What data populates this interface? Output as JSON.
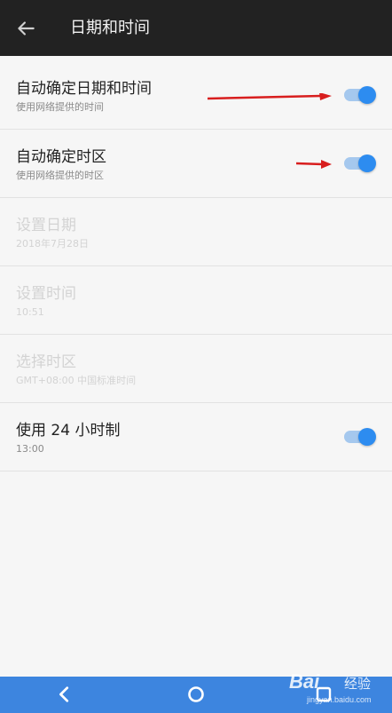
{
  "header": {
    "title": "日期和时间"
  },
  "settings": [
    {
      "title": "自动确定日期和时间",
      "subtitle": "使用网络提供的时间",
      "toggle_on": true
    },
    {
      "title": "自动确定时区",
      "subtitle": "使用网络提供的时区",
      "toggle_on": true
    },
    {
      "title": "设置日期",
      "subtitle": "2018年7月28日"
    },
    {
      "title": "设置时间",
      "subtitle": "10:51"
    },
    {
      "title": "选择时区",
      "subtitle": "GMT+08:00 中国标准时间"
    },
    {
      "title": "使用 24 小时制",
      "subtitle": "13:00",
      "toggle_on": true
    }
  ],
  "colors": {
    "accent": "#2d8cf0",
    "appbar": "#222222",
    "navbar": "#3d85df",
    "annotation_arrow": "#d81e1e"
  },
  "icons": {
    "back": "arrow-left-icon",
    "nav_back": "chevron-left-icon",
    "nav_home": "circle-home-icon",
    "nav_recents": "square-recents-icon"
  },
  "watermark": {
    "brand": "Bai",
    "brand_suffix": "经验",
    "url": "jingyan.baidu.com"
  }
}
